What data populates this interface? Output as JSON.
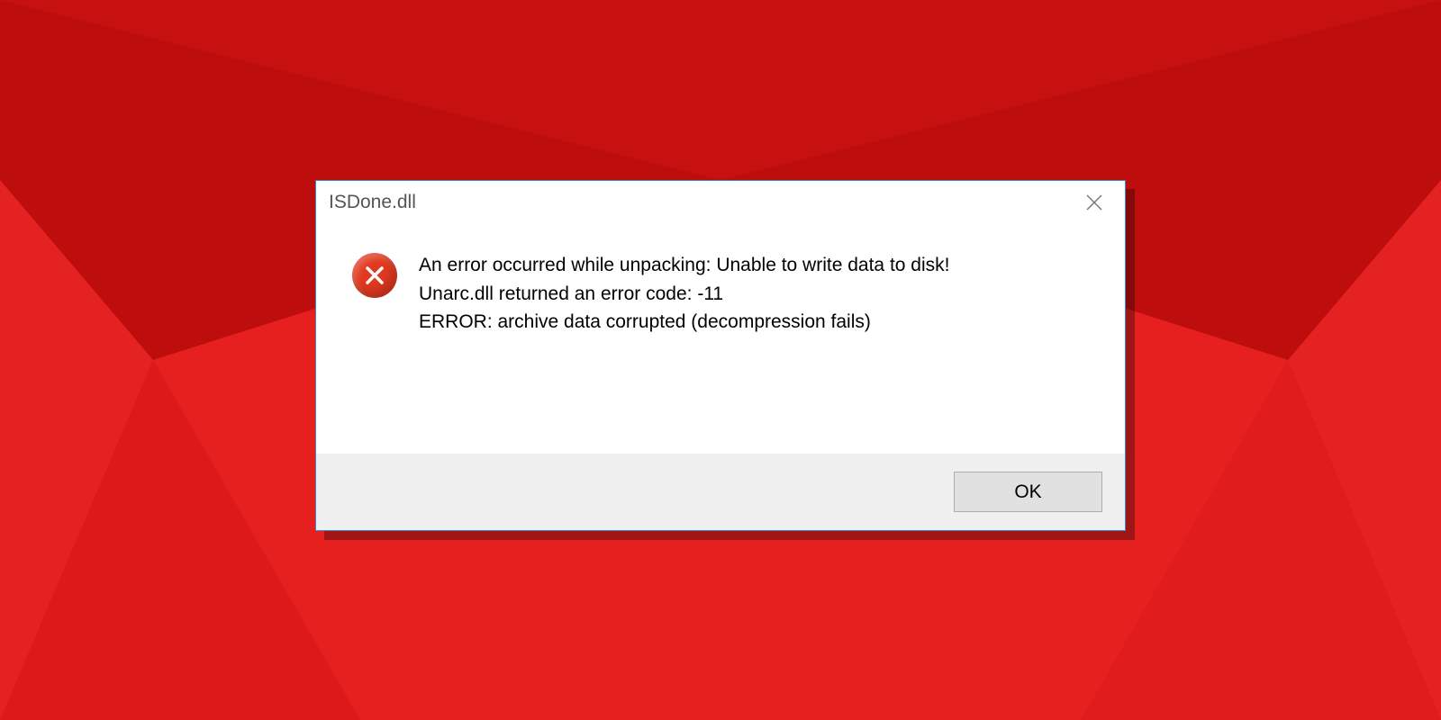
{
  "dialog": {
    "title": "ISDone.dll",
    "message": {
      "line1": "An error occurred while unpacking: Unable to write data to disk!",
      "line2": "Unarc.dll returned an error code: -11",
      "line3": "ERROR: archive data corrupted (decompression fails)"
    },
    "ok_label": "OK"
  }
}
